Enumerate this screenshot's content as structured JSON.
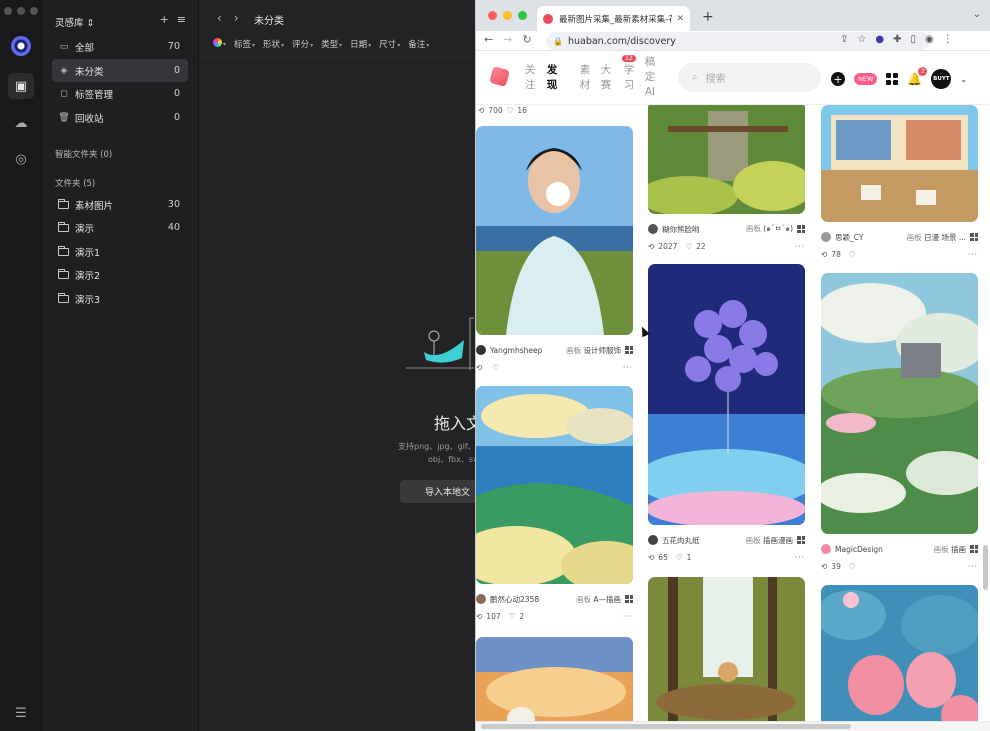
{
  "app": {
    "library_name": "灵感库",
    "nav": [
      {
        "label": "全部",
        "count": "70"
      },
      {
        "label": "未分类",
        "count": "0"
      },
      {
        "label": "标签管理",
        "count": "0"
      },
      {
        "label": "回收站",
        "count": "0"
      }
    ],
    "smart_folders_title": "智能文件夹 (0)",
    "folders_title": "文件夹 (5)",
    "folders": [
      {
        "label": "素材图片",
        "count": "30"
      },
      {
        "label": "演示",
        "count": "40"
      },
      {
        "label": "演示1",
        "count": ""
      },
      {
        "label": "演示2",
        "count": ""
      },
      {
        "label": "演示3",
        "count": ""
      }
    ],
    "breadcrumb": "未分类",
    "filters": [
      "标签",
      "形状",
      "评分",
      "类型",
      "日期",
      "尺寸",
      "备注"
    ],
    "drop_title": "拖入文",
    "drop_hint_line1": "支持png、jpg、gif、",
    "drop_hint_line2": "obj、fbx、sv",
    "import_button": "导入本地文"
  },
  "browser": {
    "tab_title": "最新图片采集_最新素材采集-花瓣",
    "url": "huaban.com/discovery",
    "site_nav": [
      {
        "label": "关注",
        "active": false
      },
      {
        "label": "发现",
        "active": true
      },
      {
        "label": "素材",
        "active": false
      },
      {
        "label": "大赛",
        "active": false
      },
      {
        "label": "学习",
        "active": false
      },
      {
        "label": "稿定AI",
        "active": false
      }
    ],
    "learn_badge": "12",
    "search_placeholder": "搜索",
    "new_badge": "NEW",
    "notify_count": "2",
    "avatar_text": "BUYT",
    "cards": [
      {
        "user": "Yangmhsheep",
        "board_prefix": "画板",
        "board": "设计师服饰",
        "saves": "",
        "likes": ""
      },
      {
        "user": "鹏然心动2358",
        "board_prefix": "画板",
        "board": "A—插画",
        "saves": "107",
        "likes": "2"
      },
      {
        "user": "糊你熊脸哟",
        "board_prefix": "画板",
        "board": "(๑´ㅂ`๑)",
        "saves": "2027",
        "likes": "22"
      },
      {
        "user": "五花肉丸纸",
        "board_prefix": "画板",
        "board": "插画漫画",
        "saves": "65",
        "likes": "1"
      },
      {
        "user": "思颖_CY",
        "board_prefix": "画板",
        "board": "日漫 场景 ...",
        "saves": "78",
        "likes": ""
      },
      {
        "user": "MagicDesign",
        "board_prefix": "画板",
        "board": "插画",
        "saves": "39",
        "likes": ""
      }
    ],
    "top_partial_stats": {
      "saves": "700",
      "likes": "16"
    }
  }
}
